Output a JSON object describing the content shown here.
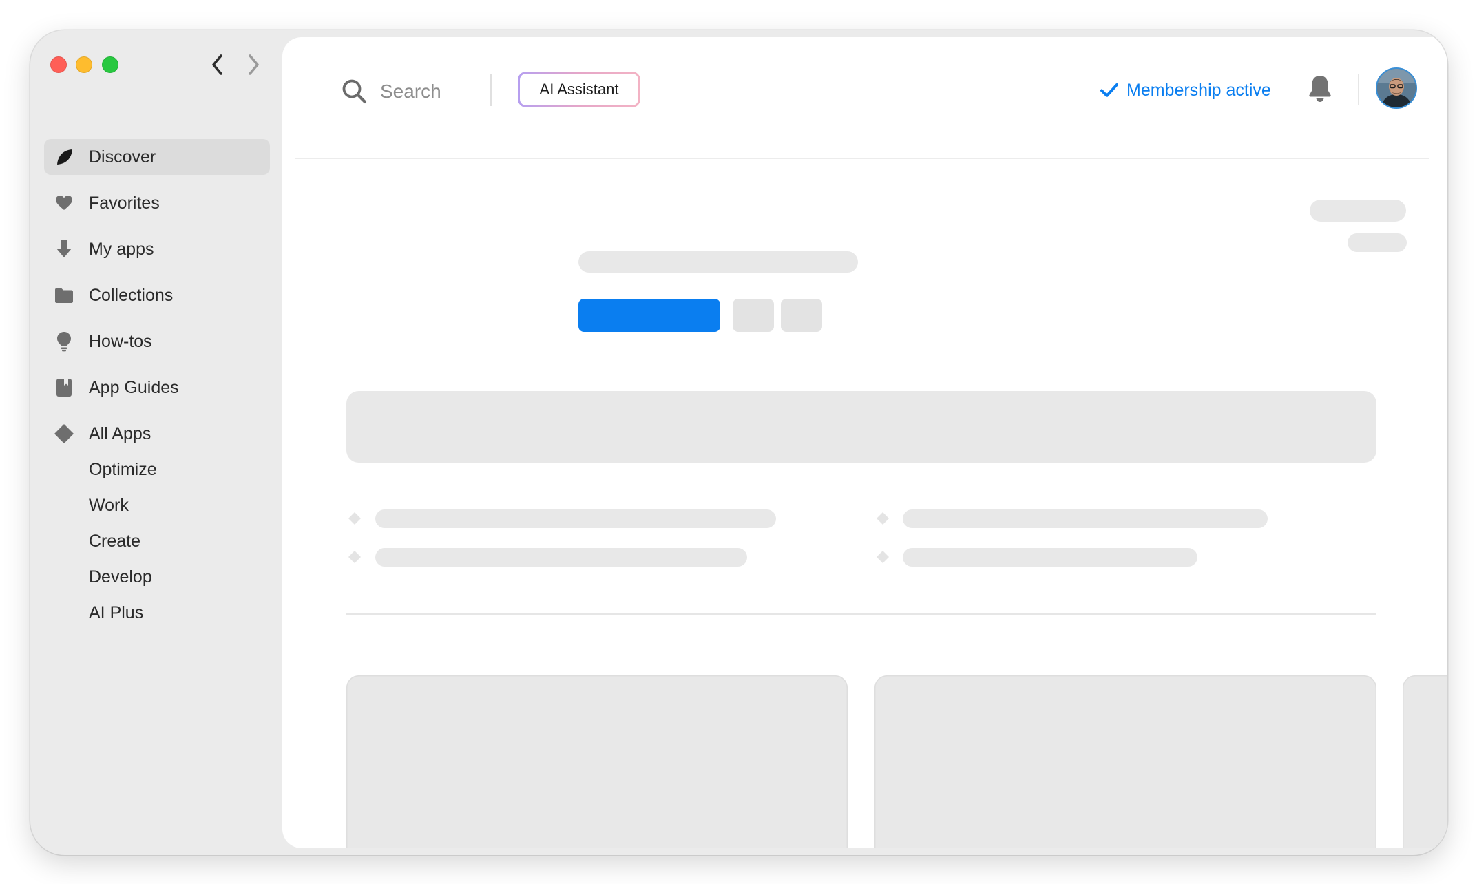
{
  "window": {
    "nav": {
      "back_icon": "chevron-left-icon",
      "forward_icon": "chevron-right-icon"
    }
  },
  "sidebar": {
    "items": [
      {
        "label": "Discover",
        "icon": "leaf-icon",
        "active": true
      },
      {
        "label": "Favorites",
        "icon": "heart-icon"
      },
      {
        "label": "My apps",
        "icon": "download-arrow-icon"
      },
      {
        "label": "Collections",
        "icon": "folder-icon"
      },
      {
        "label": "How-tos",
        "icon": "lightbulb-icon"
      },
      {
        "label": "App Guides",
        "icon": "book-icon"
      },
      {
        "label": "All Apps",
        "icon": "diamond-icon"
      }
    ],
    "sub_items": [
      {
        "label": "Optimize"
      },
      {
        "label": "Work"
      },
      {
        "label": "Create"
      },
      {
        "label": "Develop"
      },
      {
        "label": "AI Plus"
      }
    ]
  },
  "topbar": {
    "search_placeholder": "Search",
    "ai_assistant_label": "AI Assistant",
    "membership_label": "Membership active",
    "accent_color": "#0a7ef0"
  },
  "colors": {
    "primary_button": "#0a7ef0",
    "skeleton": "#e8e8e8"
  }
}
